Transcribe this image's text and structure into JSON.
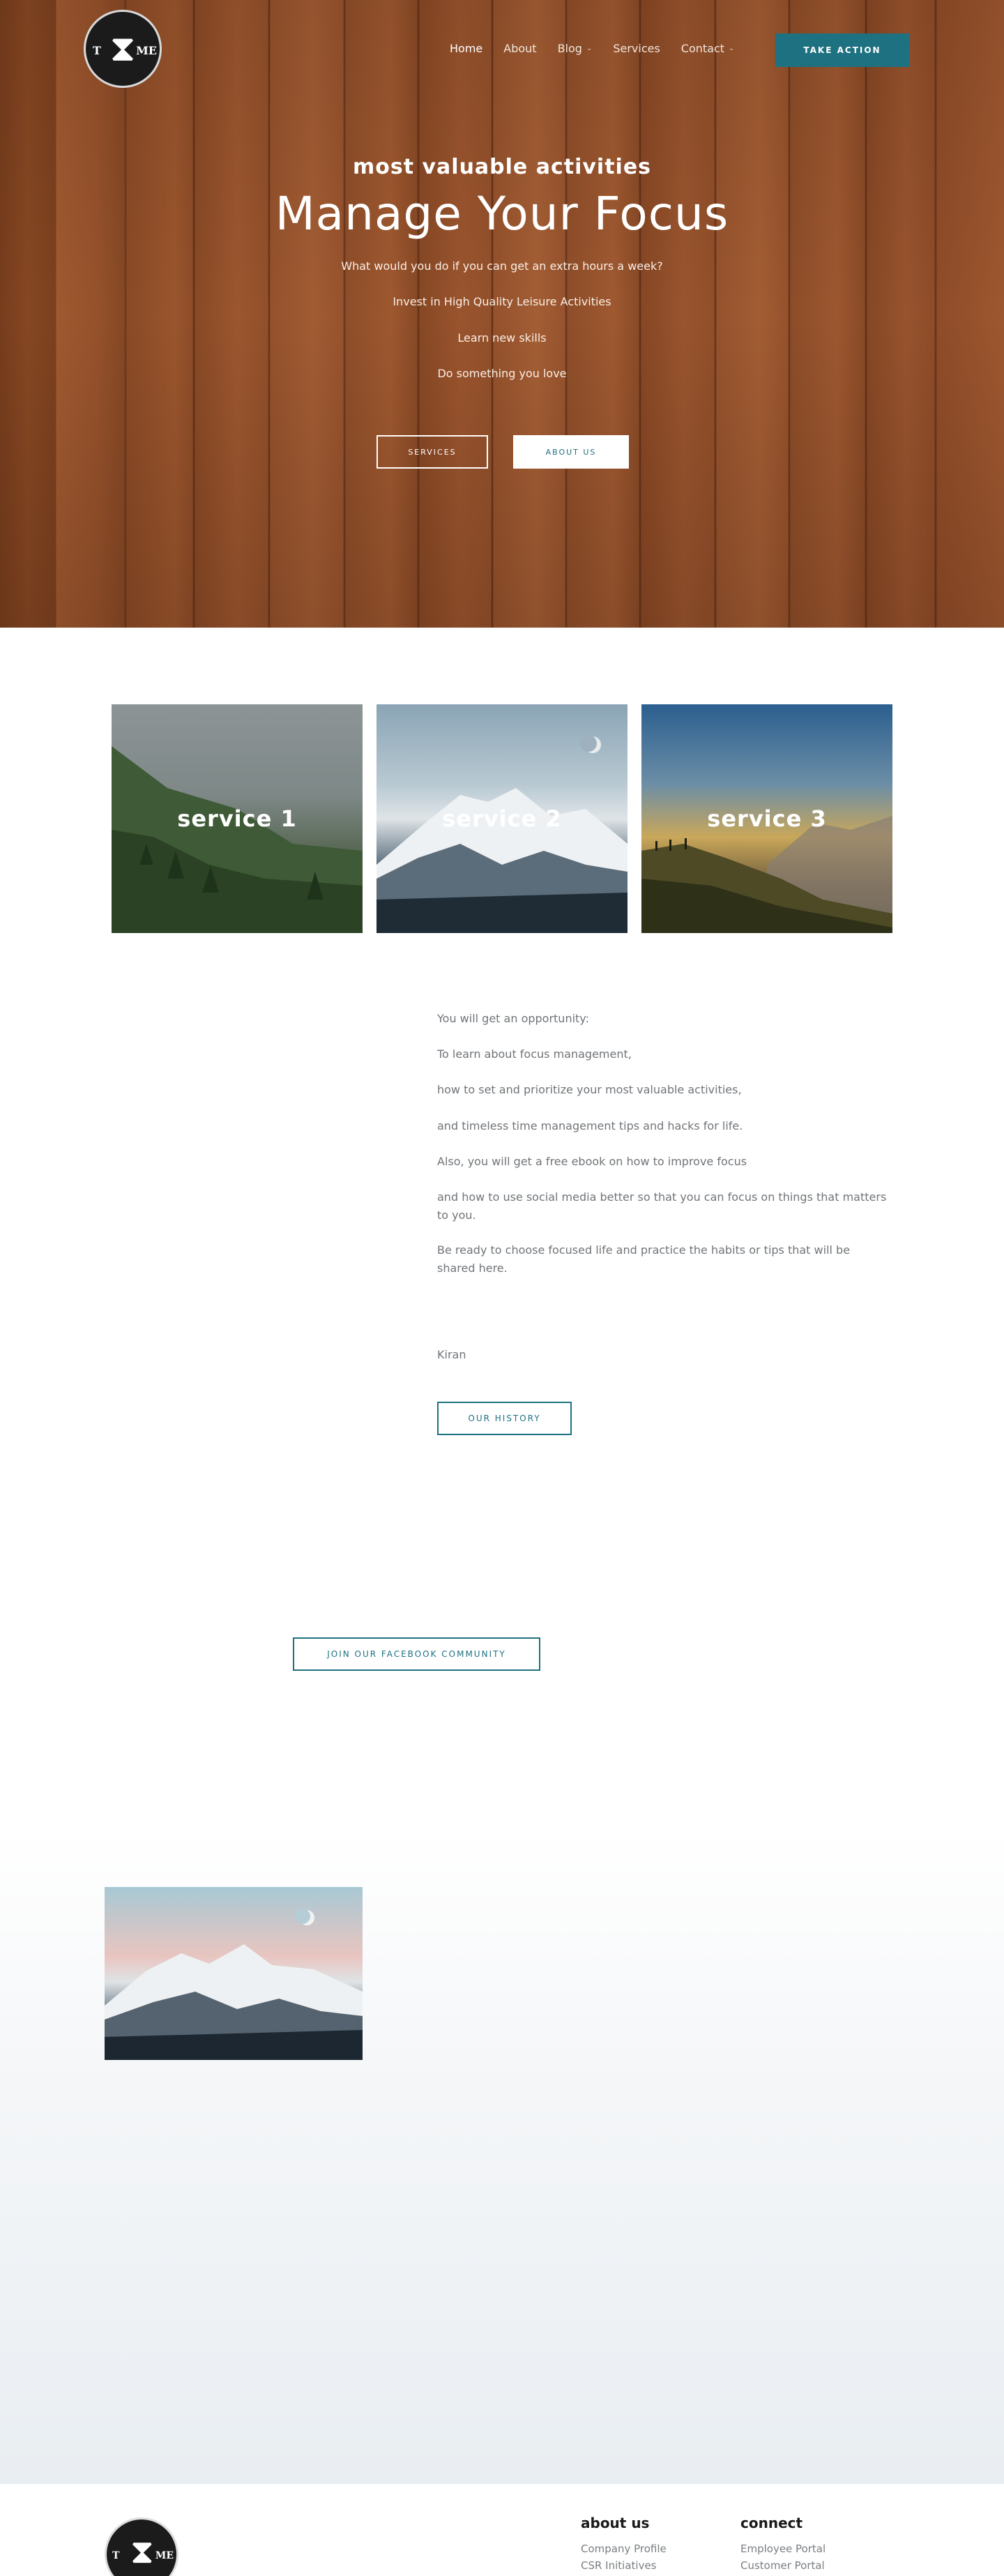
{
  "header": {
    "logo": {
      "left_letter": "T",
      "right_letters": "ME",
      "icon": "hourglass-icon"
    },
    "nav": [
      {
        "label": "Home",
        "active": true,
        "has_dropdown": false
      },
      {
        "label": "About",
        "active": false,
        "has_dropdown": false
      },
      {
        "label": "Blog",
        "active": false,
        "has_dropdown": true
      },
      {
        "label": "Services",
        "active": false,
        "has_dropdown": false
      },
      {
        "label": "Contact",
        "active": false,
        "has_dropdown": true
      }
    ],
    "cta_label": "TAKE ACTION"
  },
  "hero": {
    "subtitle": "most valuable activities",
    "title": "Manage Your Focus",
    "lines": [
      "What would you do if you can get an extra hours a week?",
      "Invest in High Quality Leisure Activities",
      "Learn new skills",
      "Do something you love"
    ],
    "buttons": {
      "services": "SERVICES",
      "about": "ABOUT US"
    }
  },
  "services": [
    {
      "label": "service 1"
    },
    {
      "label": "service 2"
    },
    {
      "label": "service 3"
    }
  ],
  "content": {
    "paragraphs": [
      "You will get an opportunity:",
      "To learn about focus management,",
      "how to set and prioritize your most valuable activities,",
      "and timeless time management tips and hacks for life.",
      "Also, you will get a free ebook on how to improve focus",
      "and how to use social media better so that you can focus on things that matters to you.",
      "Be ready to choose focused life and practice the habits or tips that will be shared here.",
      "Kiran"
    ],
    "history_button": "OUR HISTORY",
    "facebook_button": "JOIN OUR FACEBOOK COMMUNITY"
  },
  "footer": {
    "logo": {
      "left_letter": "T",
      "right_letters": "ME"
    },
    "about": {
      "heading": "about us",
      "links": [
        "Company Profile",
        "CSR Initiatives"
      ]
    },
    "connect": {
      "heading": "connect",
      "links": [
        "Employee Portal",
        "Customer Portal"
      ]
    }
  },
  "colors": {
    "accent": "#1d7180",
    "text": "#707478",
    "heading": "#1a1a1a"
  }
}
